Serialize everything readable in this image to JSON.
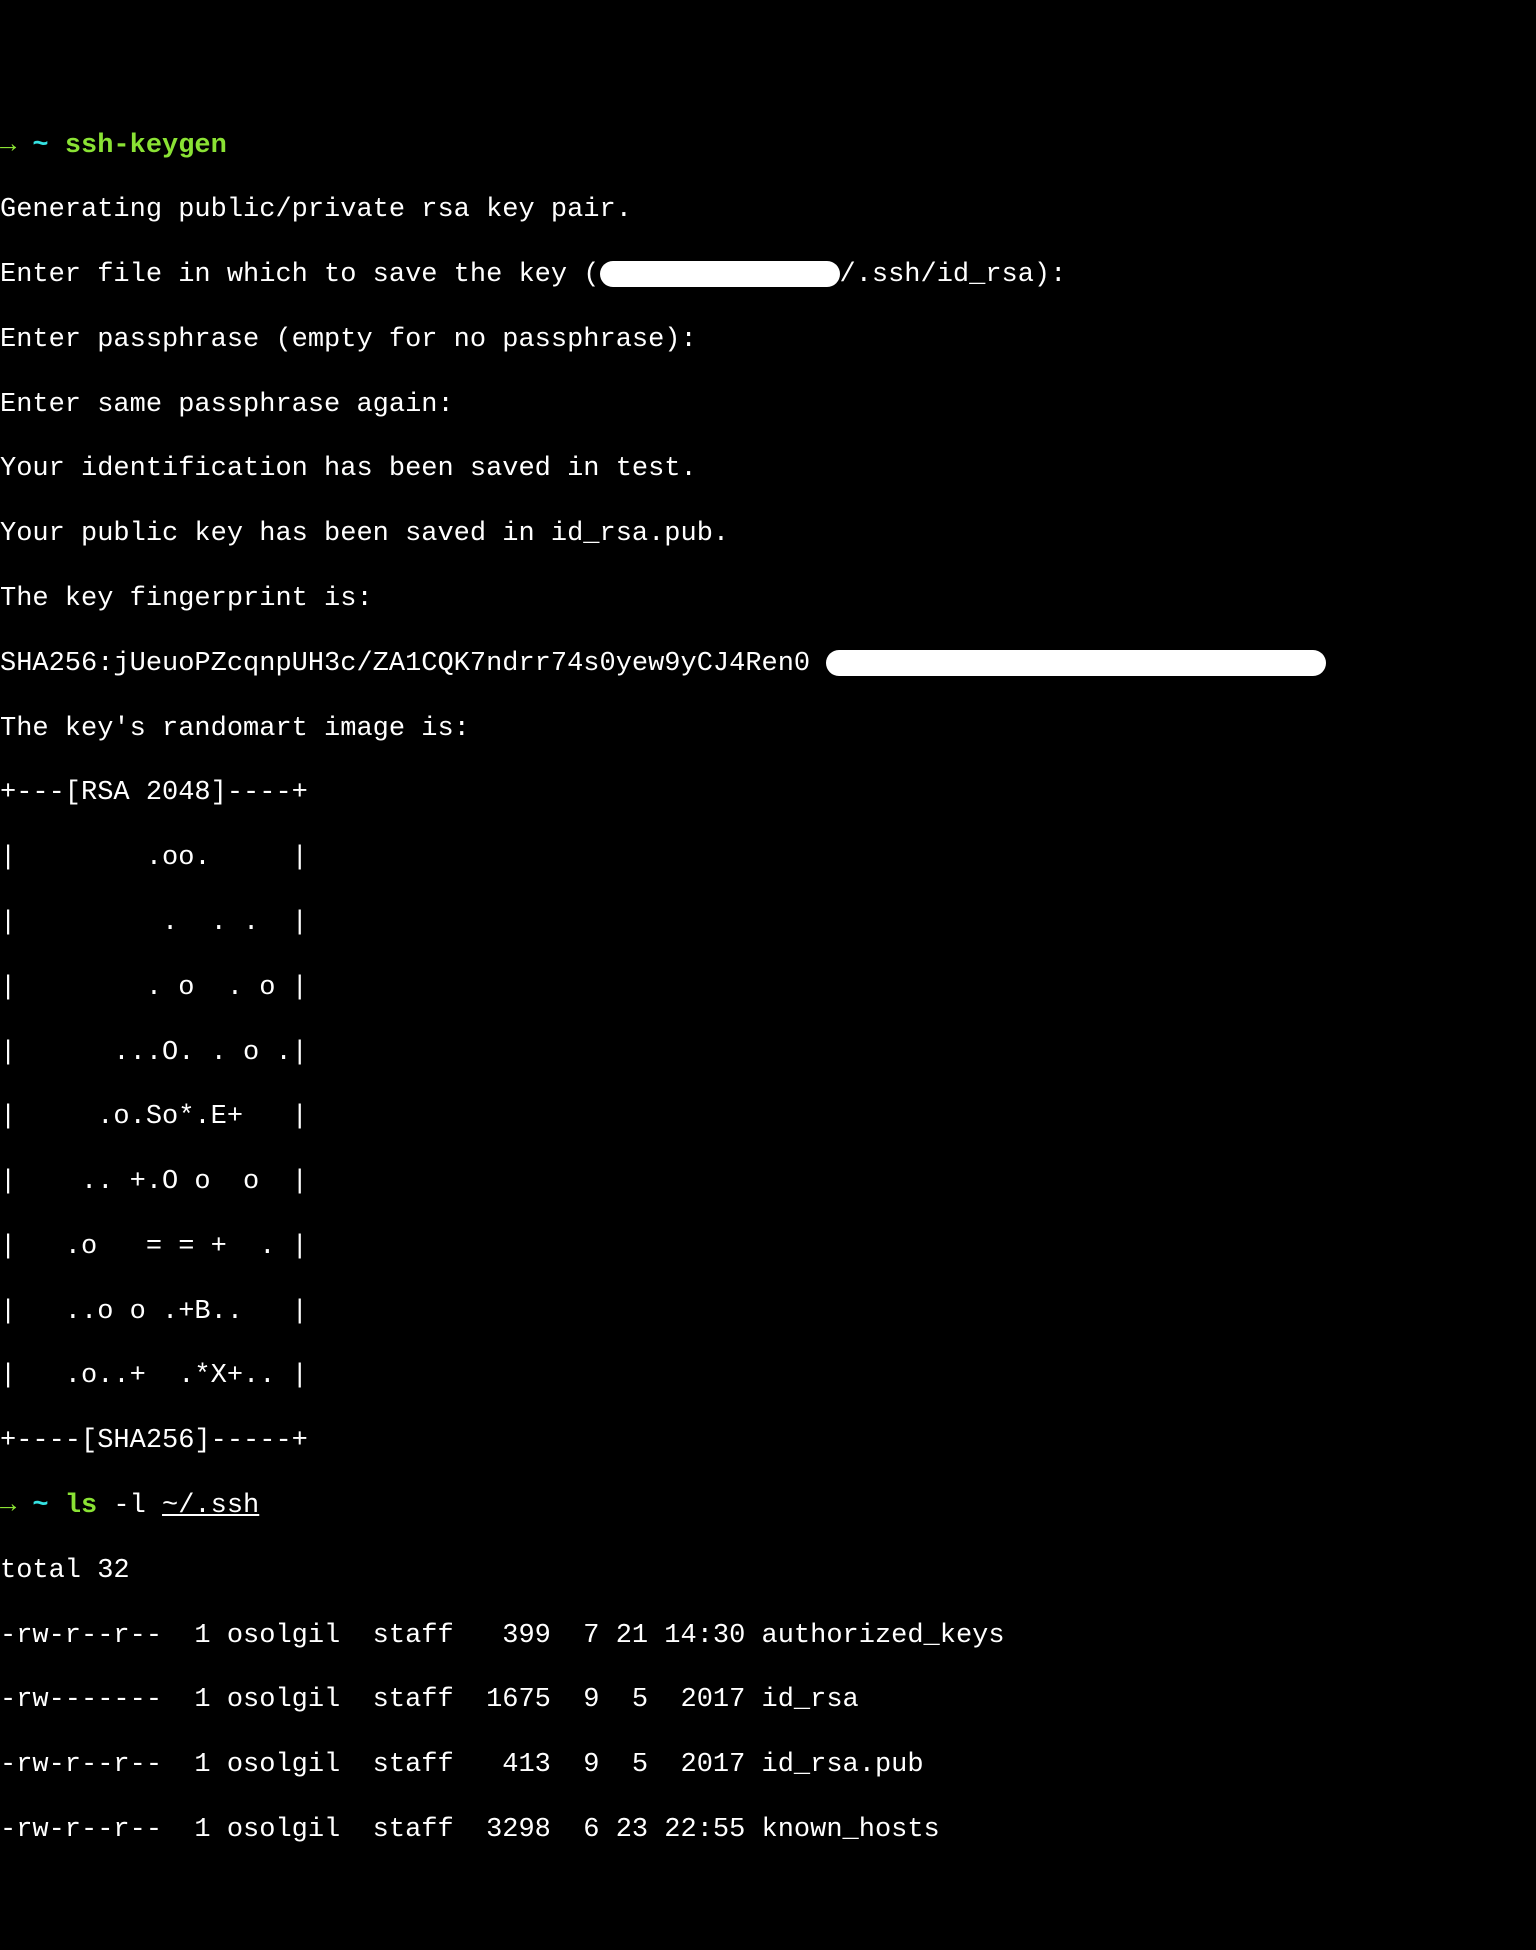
{
  "prompt1": {
    "arrow": "→",
    "tilde": " ~ ",
    "cmd": "ssh-keygen"
  },
  "lines": {
    "l1": "Generating public/private rsa key pair.",
    "l2a": "Enter file in which to save the key (",
    "l2b": "/.ssh/id_rsa):",
    "l3": "Enter passphrase (empty for no passphrase):",
    "l4": "Enter same passphrase again:",
    "l5": "Your identification has been saved in test.",
    "l6": "Your public key has been saved in id_rsa.pub.",
    "l7": "The key fingerprint is:",
    "l8a": "SHA256:jUeuoPZcqnpUH3c/ZA1CQK7ndrr74s0yew9yCJ4Ren0 ",
    "l9": "The key's randomart image is:",
    "art0": "+---[RSA 2048]----+",
    "art1": "|        .oo.     |",
    "art2": "|         .  . .  |",
    "art3": "|        . o  . o |",
    "art4": "|      ...O. . o .|",
    "art5": "|     .o.So*.E+   |",
    "art6": "|    .. +.O o  o  |",
    "art7": "|   .o   = = +  . |",
    "art8": "|   ..o o .+B..   |",
    "art9": "|   .o..+  .*X+.. |",
    "art10": "+----[SHA256]-----+"
  },
  "prompt2": {
    "arrow": "→",
    "tilde": " ~ ",
    "cmd_a": "ls",
    "cmd_b": " -l ",
    "cmd_c": "~/.ssh"
  },
  "ls": {
    "total": "total 32",
    "r1": "-rw-r--r--  1 osolgil  staff   399  7 21 14:30 authorized_keys",
    "r2": "-rw-------  1 osolgil  staff  1675  9  5  2017 id_rsa",
    "r3": "-rw-r--r--  1 osolgil  staff   413  9  5  2017 id_rsa.pub",
    "r4": "-rw-r--r--  1 osolgil  staff  3298  6 23 22:55 known_hosts"
  }
}
